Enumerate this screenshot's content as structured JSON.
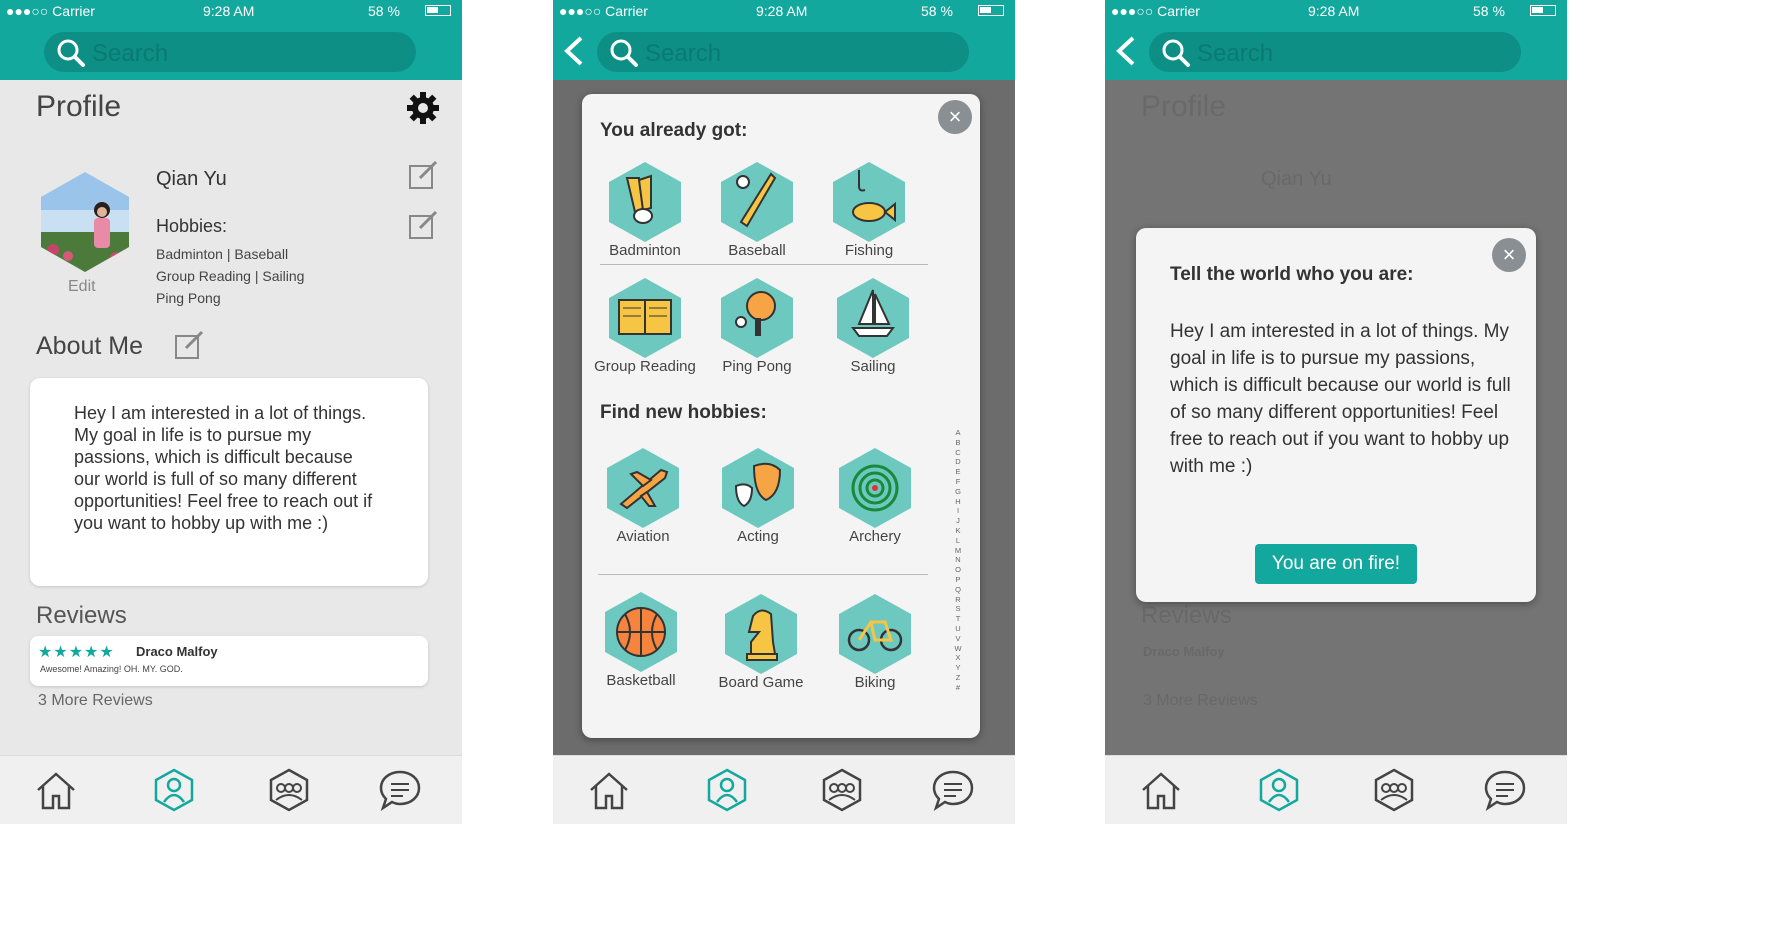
{
  "status": {
    "carrier": "●●●○○ Carrier",
    "time": "9:28 AM",
    "battery": "58 %"
  },
  "search": {
    "placeholder": "Search"
  },
  "profile": {
    "title": "Profile",
    "name": "Qian Yu",
    "hobbies_label": "Hobbies:",
    "hobbies_lines": [
      "Badminton | Baseball",
      "Group Reading | Sailing",
      "Ping Pong"
    ],
    "edit_label": "Edit",
    "about_title": "About Me",
    "about_text": "Hey I am interested in a lot of things. My goal in life is to pursue my passions, which is difficult because our world is full of so many different opportunities! Feel free to reach out if you want to hobby up with me :)",
    "reviews_title": "Reviews",
    "review": {
      "stars": 5,
      "author": "Draco Malfoy",
      "text": "Awesome! Amazing! OH. MY. GOD."
    },
    "more_reviews": "3 More Reviews"
  },
  "hobby_modal": {
    "got_title": "You already got:",
    "got": [
      "Badminton",
      "Baseball",
      "Fishing",
      "Group Reading",
      "Ping Pong",
      "Sailing"
    ],
    "find_title": "Find new hobbies:",
    "find": [
      "Aviation",
      "Acting",
      "Archery",
      "Basketball",
      "Board Game",
      "Biking"
    ],
    "alphabet": "A B C D E F G H I J K L M N O P Q R S T U V W X Y Z #",
    "close": "×"
  },
  "about_modal": {
    "title": "Tell the world who you are:",
    "text": "Hey I am interested in a lot of things. My goal in life is to pursue my passions, which is difficult because our world is full of so many different opportunities! Feel free to reach out if you want to hobby up with me :)",
    "button": "You are on fire!",
    "close": "×"
  },
  "nav": {
    "items": [
      "home-icon",
      "profile-icon",
      "groups-icon",
      "chat-icon"
    ],
    "active": 1
  },
  "colors": {
    "teal": "#13a89e",
    "teal_dark": "#0d8f86",
    "hex_fill": "#6dc8c0",
    "star": "#13a89e"
  }
}
